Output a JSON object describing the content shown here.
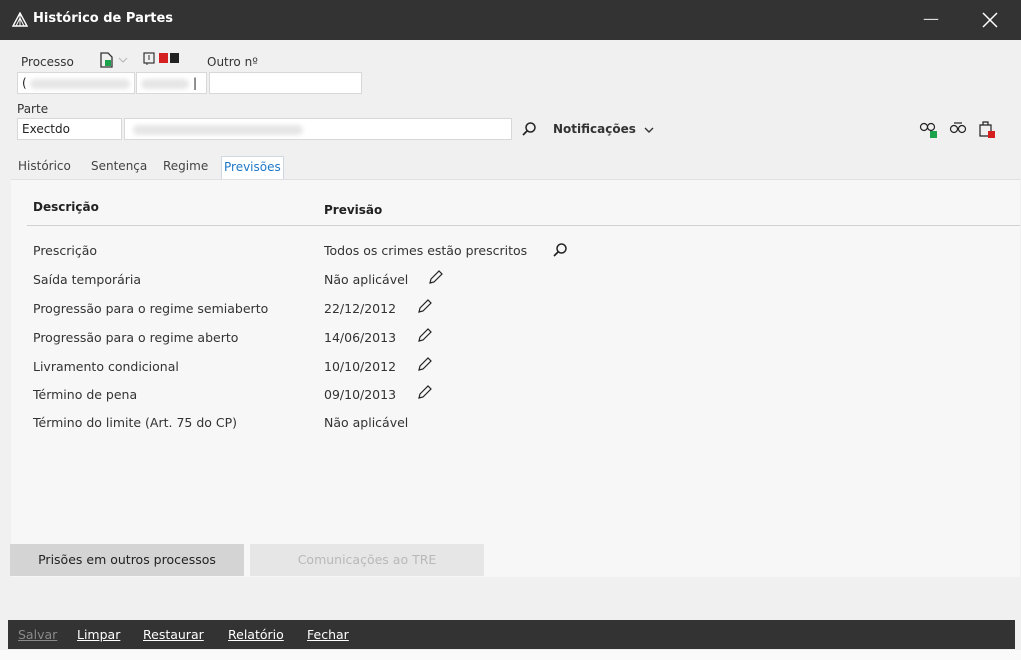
{
  "window": {
    "title": "Histórico de Partes",
    "minimize": "—"
  },
  "process": {
    "label": "Processo",
    "outro_label": "Outro nº",
    "partial_value": "(",
    "partial_value2": "|"
  },
  "parte": {
    "label": "Parte",
    "type_value": "Exectdo",
    "notifications_label": "Notificações"
  },
  "tabs": [
    {
      "label": "Histórico"
    },
    {
      "label": "Sentença"
    },
    {
      "label": "Regime"
    },
    {
      "label": "Previsões"
    }
  ],
  "table": {
    "headers": {
      "descricao": "Descrição",
      "previsao": "Previsão"
    },
    "rows": [
      {
        "descricao": "Prescrição",
        "previsao": "Todos os crimes estão prescritos"
      },
      {
        "descricao": "Saída temporária",
        "previsao": "Não aplicável"
      },
      {
        "descricao": "Progressão para o regime semiaberto",
        "previsao": "22/12/2012"
      },
      {
        "descricao": "Progressão para o regime aberto",
        "previsao": "14/06/2013"
      },
      {
        "descricao": "Livramento condicional",
        "previsao": "10/10/2012"
      },
      {
        "descricao": "Término de pena",
        "previsao": "09/10/2013"
      },
      {
        "descricao": "Término do limite (Art. 75 do CP)",
        "previsao": "Não aplicável"
      }
    ]
  },
  "buttons": {
    "prisoes": "Prisões em outros processos",
    "comunicacoes": "Comunicações ao TRE"
  },
  "actions": {
    "salvar": "Salvar",
    "limpar": "Limpar",
    "restaurar": "Restaurar",
    "relatorio": "Relatório",
    "fechar": "Fechar"
  },
  "colors": {
    "titlebar": "#333333",
    "accent": "#1e78c8",
    "red": "#d42020"
  }
}
